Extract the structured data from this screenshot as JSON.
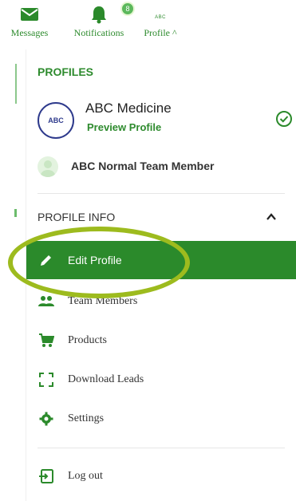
{
  "topnav": {
    "messages_label": "Messages",
    "notifications_label": "Notifications",
    "notifications_badge": "8",
    "profile_label": "Profile ^",
    "profile_logo_text": "ABC"
  },
  "profiles": {
    "title": "PROFILES",
    "current": {
      "avatar_text": "ABC",
      "name": "ABC Medicine",
      "link_label": "Preview Profile"
    },
    "member": {
      "name": "ABC Normal Team Member"
    }
  },
  "profile_info": {
    "title": "PROFILE INFO"
  },
  "menu": {
    "edit_profile": "Edit Profile",
    "team_members": "Team Members",
    "products": "Products",
    "download_leads": "Download Leads",
    "settings": "Settings",
    "logout": "Log out"
  },
  "colors": {
    "accent": "#2b8a2b",
    "highlight_ring": "#9dbb1e",
    "brand_text": "#2e8b2e"
  }
}
